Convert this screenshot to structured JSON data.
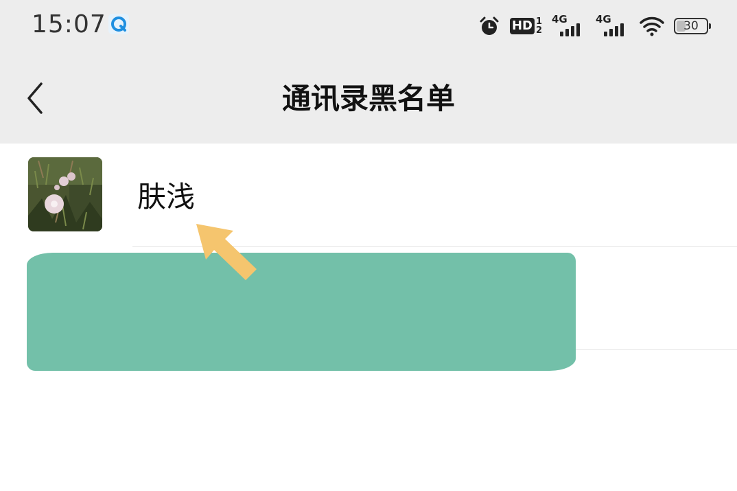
{
  "status_bar": {
    "time": "15:07",
    "hd_label": "HD",
    "hd_sim_top": "1",
    "hd_sim_bottom": "2",
    "sim1_network": "4G",
    "sim2_network": "4G",
    "battery_level": "30",
    "battery_fraction": 0.3,
    "icons": [
      "app-notification-icon",
      "alarm-clock-icon",
      "hd-voice-icon",
      "signal-icon",
      "wifi-icon",
      "battery-icon"
    ]
  },
  "header": {
    "title": "通讯录黑名单",
    "back_icon": "chevron-left-icon"
  },
  "blacklist": {
    "items": [
      {
        "name": "肤浅",
        "avatar": "flower-photo"
      }
    ]
  },
  "colors": {
    "status_bar_bg": "#ededed",
    "title_bar_bg": "#ededed",
    "page_bg": "#ffffff",
    "redaction": "#73c0a9",
    "arrow": "#f5c56e",
    "text_primary": "#111111"
  }
}
